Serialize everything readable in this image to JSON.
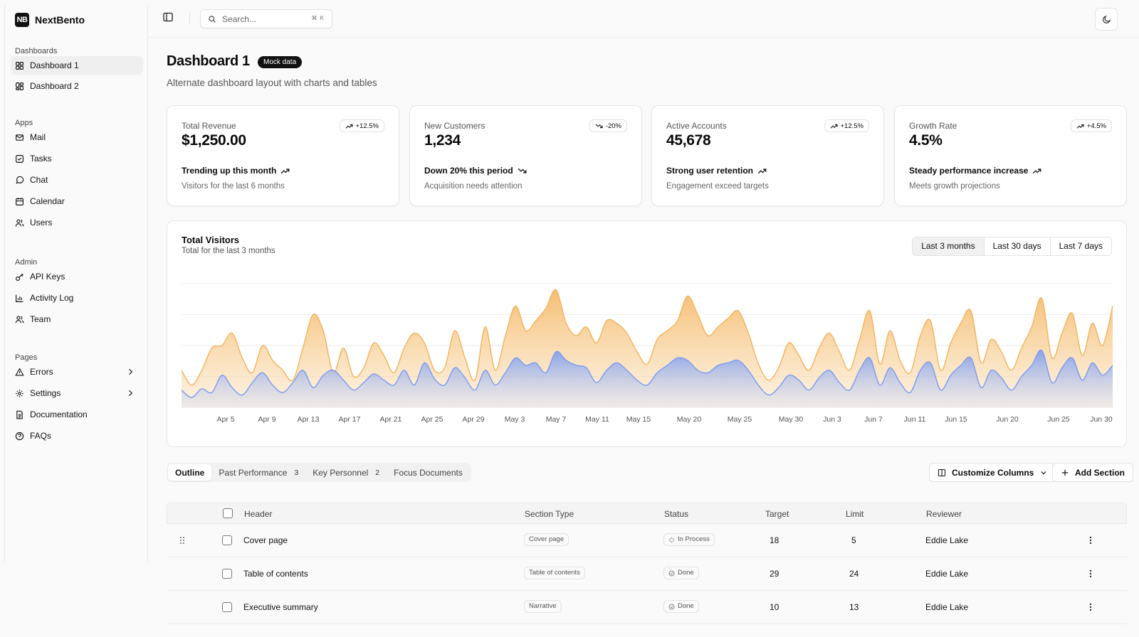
{
  "brand": {
    "logo": "NB",
    "name": "NextBento"
  },
  "sidebar": {
    "groups": [
      {
        "label": "Dashboards",
        "items": [
          {
            "label": "Dashboard 1",
            "icon": "layout-grid-icon",
            "active": true
          },
          {
            "label": "Dashboard 2",
            "icon": "layout-dashboard-icon"
          }
        ]
      },
      {
        "label": "Apps",
        "items": [
          {
            "label": "Mail",
            "icon": "mail-icon"
          },
          {
            "label": "Tasks",
            "icon": "square-check-icon"
          },
          {
            "label": "Chat",
            "icon": "message-circle-icon"
          },
          {
            "label": "Calendar",
            "icon": "calendar-icon"
          },
          {
            "label": "Users",
            "icon": "users-icon"
          }
        ]
      },
      {
        "label": "Admin",
        "items": [
          {
            "label": "API Keys",
            "icon": "key-icon"
          },
          {
            "label": "Activity Log",
            "icon": "bar-chart-icon"
          },
          {
            "label": "Team",
            "icon": "team-icon"
          }
        ]
      },
      {
        "label": "Pages",
        "items": [
          {
            "label": "Errors",
            "icon": "alert-triangle-icon"
          },
          {
            "label": "Settings",
            "icon": "gear-icon"
          },
          {
            "label": "Documentation",
            "icon": "document-icon"
          },
          {
            "label": "FAQs",
            "icon": "help-circle-icon"
          }
        ]
      }
    ]
  },
  "topbar": {
    "search_placeholder": "Search...",
    "shortcut": "⌘ K"
  },
  "header": {
    "title": "Dashboard 1",
    "badge": "Mock data",
    "subtitle": "Alternate dashboard layout with charts and tables"
  },
  "kpis": [
    {
      "label": "Total Revenue",
      "value": "$1,250.00",
      "change": "+12.5%",
      "direction": "up",
      "trend": "Trending up this month",
      "note": "Visitors for the last 6 months"
    },
    {
      "label": "New Customers",
      "value": "1,234",
      "change": "-20%",
      "direction": "down",
      "trend": "Down 20% this period",
      "note": "Acquisition needs attention"
    },
    {
      "label": "Active Accounts",
      "value": "45,678",
      "change": "+12.5%",
      "direction": "up",
      "trend": "Strong user retention",
      "note": "Engagement exceed targets"
    },
    {
      "label": "Growth Rate",
      "value": "4.5%",
      "change": "+4.5%",
      "direction": "up",
      "trend": "Steady performance increase",
      "note": "Meets growth projections"
    }
  ],
  "visitors": {
    "title": "Total Visitors",
    "subtitle": "Total for the last 3 months",
    "ranges": [
      "Last 3 months",
      "Last 30 days",
      "Last 7 days"
    ],
    "active_range": "Last 3 months"
  },
  "chart_data": {
    "type": "area",
    "x_tick_labels": [
      "Apr 5",
      "Apr 9",
      "Apr 13",
      "Apr 17",
      "Apr 21",
      "Apr 25",
      "Apr 29",
      "May 3",
      "May 7",
      "May 11",
      "May 15",
      "May 20",
      "May 25",
      "May 30",
      "Jun 3",
      "Jun 7",
      "Jun 11",
      "Jun 15",
      "Jun 20",
      "Jun 25",
      "Jun 30"
    ],
    "grid": true,
    "series": [
      {
        "color": "#f4b25a",
        "values": [
          0.3,
          0.18,
          0.3,
          0.48,
          0.5,
          0.6,
          0.4,
          0.28,
          0.5,
          0.38,
          0.3,
          0.22,
          0.48,
          0.75,
          0.62,
          0.28,
          0.48,
          0.25,
          0.32,
          0.52,
          0.42,
          0.28,
          0.48,
          0.6,
          0.52,
          0.3,
          0.32,
          0.62,
          0.4,
          0.22,
          0.65,
          0.3,
          0.58,
          0.82,
          0.62,
          0.7,
          0.8,
          0.95,
          0.68,
          0.58,
          0.65,
          0.52,
          0.7,
          0.68,
          0.6,
          0.45,
          0.35,
          0.55,
          0.62,
          0.7,
          0.9,
          0.75,
          0.58,
          0.65,
          0.72,
          0.78,
          0.6,
          0.35,
          0.22,
          0.32,
          0.52,
          0.42,
          0.3,
          0.48,
          0.6,
          0.45,
          0.3,
          0.55,
          0.78,
          0.35,
          0.62,
          0.38,
          0.28,
          0.58,
          0.7,
          0.3,
          0.52,
          0.68,
          0.78,
          0.36,
          0.55,
          0.45,
          0.3,
          0.48,
          0.65,
          0.88,
          0.4,
          0.6,
          0.76,
          0.42,
          0.68,
          0.5,
          0.82
        ]
      },
      {
        "color": "#7b9cf0",
        "values": [
          0.14,
          0.08,
          0.15,
          0.12,
          0.26,
          0.16,
          0.1,
          0.2,
          0.28,
          0.18,
          0.12,
          0.2,
          0.3,
          0.16,
          0.26,
          0.3,
          0.22,
          0.14,
          0.2,
          0.27,
          0.22,
          0.18,
          0.3,
          0.18,
          0.36,
          0.23,
          0.18,
          0.32,
          0.24,
          0.14,
          0.3,
          0.18,
          0.28,
          0.4,
          0.34,
          0.36,
          0.28,
          0.45,
          0.38,
          0.34,
          0.32,
          0.2,
          0.3,
          0.36,
          0.3,
          0.22,
          0.18,
          0.28,
          0.34,
          0.4,
          0.38,
          0.3,
          0.28,
          0.34,
          0.36,
          0.38,
          0.3,
          0.18,
          0.1,
          0.16,
          0.26,
          0.22,
          0.14,
          0.24,
          0.3,
          0.2,
          0.14,
          0.3,
          0.4,
          0.18,
          0.32,
          0.2,
          0.12,
          0.3,
          0.36,
          0.14,
          0.26,
          0.34,
          0.4,
          0.16,
          0.3,
          0.24,
          0.14,
          0.25,
          0.34,
          0.46,
          0.2,
          0.32,
          0.4,
          0.22,
          0.36,
          0.26,
          0.34
        ]
      }
    ]
  },
  "tabs": [
    {
      "label": "Outline",
      "active": true
    },
    {
      "label": "Past Performance",
      "count": "3"
    },
    {
      "label": "Key Personnel",
      "count": "2"
    },
    {
      "label": "Focus Documents"
    }
  ],
  "actions": {
    "customize": "Customize Columns",
    "add": "Add Section"
  },
  "table": {
    "columns": [
      "Header",
      "Section Type",
      "Status",
      "Target",
      "Limit",
      "Reviewer"
    ],
    "rows": [
      {
        "header": "Cover page",
        "type": "Cover page",
        "status": "In Process",
        "status_icon": "loader-icon",
        "target": "18",
        "limit": "5",
        "reviewer": "Eddie Lake"
      },
      {
        "header": "Table of contents",
        "type": "Table of contents",
        "status": "Done",
        "status_icon": "check-circle-icon",
        "target": "29",
        "limit": "24",
        "reviewer": "Eddie Lake"
      },
      {
        "header": "Executive summary",
        "type": "Narrative",
        "status": "Done",
        "status_icon": "check-circle-icon",
        "target": "10",
        "limit": "13",
        "reviewer": "Eddie Lake"
      }
    ]
  }
}
